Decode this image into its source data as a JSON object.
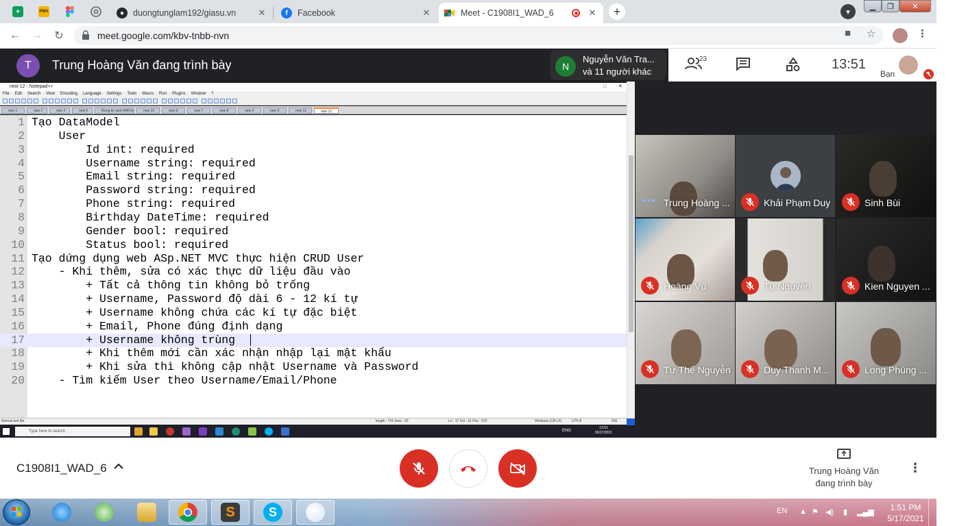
{
  "browser": {
    "tabs": [
      {
        "label": "duongtunglam192/giasu.vn",
        "icon": "github-icon"
      },
      {
        "label": "Facebook",
        "icon": "facebook-icon"
      },
      {
        "label": "Meet - C1908I1_WAD_6",
        "icon": "meet-icon",
        "active": true
      }
    ],
    "pinned_icons": [
      "sheets-icon",
      "pma-icon",
      "figma-icon",
      "chrome-icon"
    ],
    "pma_label": "PMA",
    "url": "meet.google.com/kbv-tnbb-nvn"
  },
  "meet": {
    "presenter_initial": "T",
    "presenter_text": "Trung Hoàng Văn đang trình bày",
    "people_chip": {
      "initial": "N",
      "line1": "Nguyễn Văn Tra...",
      "line2": "và 11 người khác"
    },
    "people_count": "23",
    "clock": "13:51",
    "self_label": "Bạn",
    "meeting_name": "C1908I1_WAD_6",
    "present_label_1": "Trung Hoàng Văn",
    "present_label_2": "đang trình bày",
    "participants": [
      {
        "name": "Trung Hoàng ...",
        "muted": false
      },
      {
        "name": "Khải Phạm Duy",
        "muted": true
      },
      {
        "name": "Sinh Bùi",
        "muted": true
      },
      {
        "name": "Hoàng Vũ",
        "muted": true
      },
      {
        "name": "Tú Nguyễn",
        "muted": true
      },
      {
        "name": "Kien Nguyen ...",
        "muted": true
      },
      {
        "name": "Tư Thế Nguyễn",
        "muted": true
      },
      {
        "name": "Duy Thanh M...",
        "muted": true
      },
      {
        "name": "Long Phùng ...",
        "muted": true
      }
    ]
  },
  "notepad": {
    "title": "new 12 - Notepad++",
    "menu": [
      "File",
      "Edit",
      "Search",
      "View",
      "Encoding",
      "Language",
      "Settings",
      "Tools",
      "Macro",
      "Run",
      "Plugins",
      "Window",
      "?"
    ],
    "tabs": [
      "new 1",
      "new 2",
      "new 3",
      "new 5",
      "thong tin web-WAT.txt",
      "new 10",
      "new 6",
      "new 7",
      "new 8",
      "new 4",
      "new 9",
      "new 11",
      "new 12"
    ],
    "lines": [
      {
        "n": "1",
        "text": "Tạo DataModel"
      },
      {
        "n": "2",
        "text": "    User"
      },
      {
        "n": "3",
        "text": "        Id int: required"
      },
      {
        "n": "4",
        "text": "        Username string: required"
      },
      {
        "n": "5",
        "text": "        Email string: required"
      },
      {
        "n": "6",
        "text": "        Password string: required"
      },
      {
        "n": "7",
        "text": "        Phone string: required"
      },
      {
        "n": "8",
        "text": "        Birthday DateTime: required"
      },
      {
        "n": "9",
        "text": "        Gender bool: required"
      },
      {
        "n": "10",
        "text": "        Status bool: required"
      },
      {
        "n": "11",
        "text": "Tạo dứng dụng web ASp.NET MVC thực hiện CRUD User"
      },
      {
        "n": "12",
        "text": "    - Khi thêm, sửa có xác thực dữ liệu đầu vào"
      },
      {
        "n": "13",
        "text": "        + Tất cả thông tin không bỏ trống"
      },
      {
        "n": "14",
        "text": "        + Username, Password độ dài 6 - 12 kí tự"
      },
      {
        "n": "15",
        "text": "        + Username không chứa các kí tự đặc biệt"
      },
      {
        "n": "16",
        "text": "        + Email, Phone đúng định dạng"
      },
      {
        "n": "17",
        "text": "        + Username không trùng"
      },
      {
        "n": "18",
        "text": "        + Khi thêm mới cần xác nhận nhập lại mật khẩu"
      },
      {
        "n": "19",
        "text": "        + Khi sửa thì không cập nhật Username và Password"
      },
      {
        "n": "20",
        "text": "    - Tìm kiếm User theo Username/Email/Phone"
      }
    ],
    "highlighted_line": 17,
    "status_left": "Normal text file",
    "status_length": "length : 751    lines : 20",
    "status_pos": "Ln : 17    Col : 31    Pos : 570",
    "status_eol": "Windows (CR LF)",
    "status_enc": "UTF-8",
    "status_ins": "INS",
    "inner_search": "Type here to search",
    "inner_clock_time": "13:51",
    "inner_clock_date": "05/17/2021",
    "inner_lang": "ENG"
  },
  "taskbar": {
    "lang": "EN",
    "time": "1:51 PM",
    "date": "5/17/2021"
  }
}
